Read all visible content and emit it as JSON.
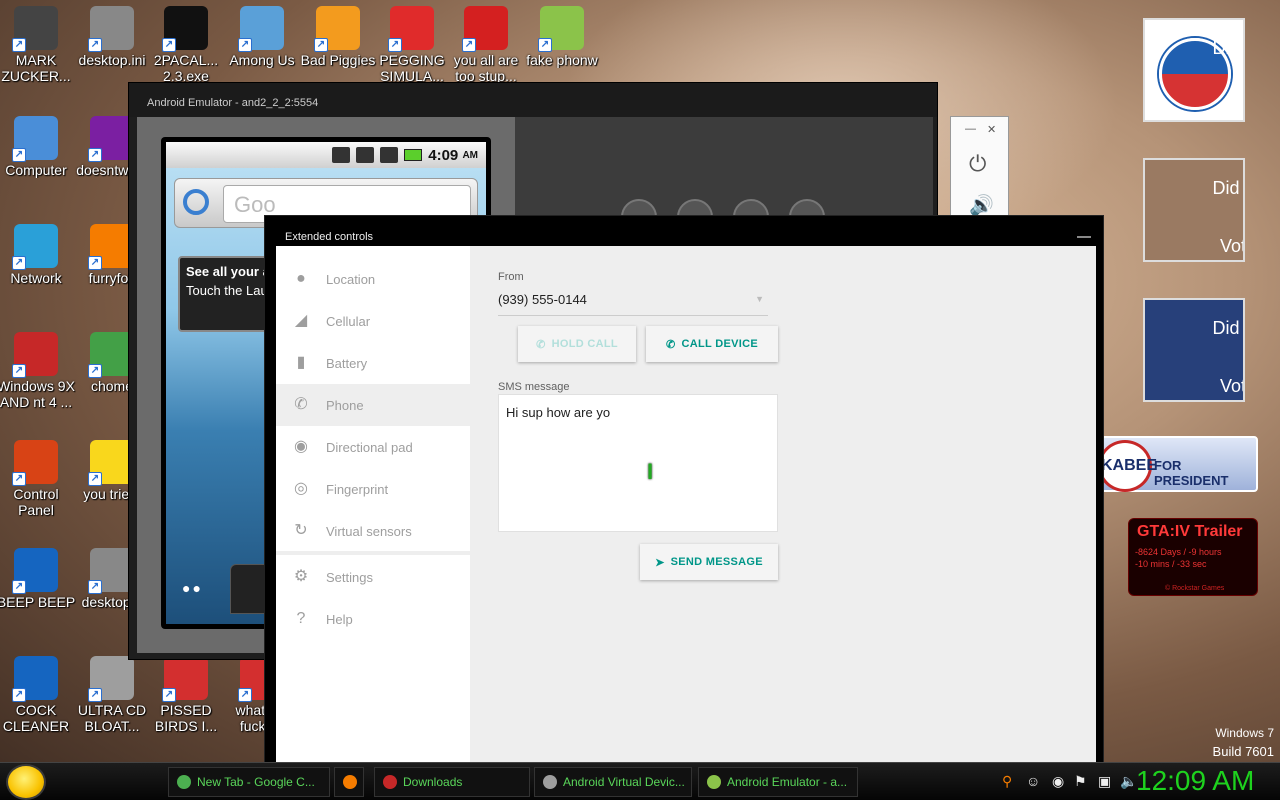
{
  "desktop_icons": [
    {
      "label": "MARK ZUCKER...",
      "icon": "mark-zuckerberg-icon",
      "color": "#444"
    },
    {
      "label": "desktop.ini",
      "icon": "settings-file-icon",
      "color": "#888"
    },
    {
      "label": "2PACAL... 2.3.exe",
      "icon": "console-icon",
      "color": "#111"
    },
    {
      "label": "Among Us",
      "icon": "among-us-icon",
      "color": "#5aa0d8"
    },
    {
      "label": "Bad Piggies",
      "icon": "bad-piggies-icon",
      "color": "#f39b1e"
    },
    {
      "label": "PEGGING SIMULA...",
      "icon": "pegging-icon",
      "color": "#e02b2b"
    },
    {
      "label": "you all are too stup...",
      "icon": "dev-cpp-icon",
      "color": "#d42020"
    },
    {
      "label": "fake phonw",
      "icon": "android-icon",
      "color": "#8bc34a"
    },
    {
      "label": "Computer",
      "icon": "computer-icon",
      "color": "#4a8ed8"
    },
    {
      "label": "doesntwo...",
      "icon": "yahoo-icon",
      "color": "#7b1fa2"
    },
    {
      "label": "Network",
      "icon": "network-icon",
      "color": "#2aa0d8"
    },
    {
      "label": "furryfox",
      "icon": "firefox-icon",
      "color": "#f57c00"
    },
    {
      "label": "Windows 9X AND nt 4 ...",
      "icon": "recycle-bin-icon",
      "color": "#c62828"
    },
    {
      "label": "chome",
      "icon": "chrome-icon",
      "color": "#43a047"
    },
    {
      "label": "Control Panel",
      "icon": "control-panel-icon",
      "color": "#d84315"
    },
    {
      "label": "you trie...",
      "icon": "star-icon",
      "color": "#f9d71c"
    },
    {
      "label": "BEEP BEEP",
      "icon": "bluescreen-icon",
      "color": "#1565c0"
    },
    {
      "label": "desktop...",
      "icon": "settings-file-icon",
      "color": "#888"
    },
    {
      "label": "COCK CLEANER",
      "icon": "bluescreen-icon",
      "color": "#1565c0"
    },
    {
      "label": "ULTRA CD BLOAT...",
      "icon": "cd-icon",
      "color": "#9e9e9e"
    },
    {
      "label": "PISSED BIRDS I...",
      "icon": "angry-birds-icon",
      "color": "#d32f2f"
    },
    {
      "label": "what the fuck i...",
      "icon": "angry-birds-icon",
      "color": "#d32f2f"
    }
  ],
  "gadgets": [
    {
      "line1": "Did you",
      "line2": "Vote?",
      "name": "vote-gadget-obama"
    },
    {
      "line1": "Did you",
      "line2": "Vote?",
      "name": "vote-gadget-mccain"
    },
    {
      "line1": "Did you",
      "line2": "Vote?",
      "name": "vote-gadget-clinton"
    }
  ],
  "huckabee": {
    "text": "KABEE",
    "sub": "FOR PRESIDENT"
  },
  "gta": {
    "title": "GTA:IV  Trailer",
    "line1": "-8624 Days / -9 hours",
    "line2": "-10 mins / -33 sec",
    "brand": "© Rockstar Games"
  },
  "emulator": {
    "title": "Android Emulator - and2_2_2:5554",
    "time": "4:09",
    "ampm": "AM",
    "search_placeholder": "Goo",
    "tip_title": "See all your a",
    "tip_text": "Touch the Lau"
  },
  "extended": {
    "title": "Extended controls",
    "nav": [
      {
        "label": "Location",
        "icon": "location-pin-icon",
        "glyph": "●"
      },
      {
        "label": "Cellular",
        "icon": "cellular-signal-icon",
        "glyph": "◢"
      },
      {
        "label": "Battery",
        "icon": "battery-icon",
        "glyph": "▮"
      },
      {
        "label": "Phone",
        "icon": "phone-icon",
        "glyph": "✆"
      },
      {
        "label": "Directional pad",
        "icon": "dpad-icon",
        "glyph": "◉"
      },
      {
        "label": "Fingerprint",
        "icon": "fingerprint-icon",
        "glyph": "◎"
      },
      {
        "label": "Virtual sensors",
        "icon": "rotate-icon",
        "glyph": "↻"
      },
      {
        "label": "Settings",
        "icon": "gear-icon",
        "glyph": "⚙"
      },
      {
        "label": "Help",
        "icon": "help-icon",
        "glyph": "?"
      }
    ],
    "selected": "Phone",
    "from_label": "From",
    "from_value": "(939) 555-0144",
    "hold_call": "HOLD CALL",
    "call_device": "CALL DEVICE",
    "sms_label": "SMS message",
    "sms_value": "Hi sup how are yo",
    "send_message": "SEND MESSAGE"
  },
  "watermark": {
    "line1": "Windows 7",
    "line2": "Build 7601"
  },
  "taskbar": {
    "buttons": [
      {
        "label": "New Tab - Google C...",
        "icon": "chrome-icon"
      },
      {
        "label": "",
        "icon": "firefox-icon"
      },
      {
        "label": "Downloads",
        "icon": "folder-icon"
      },
      {
        "label": "Android Virtual Devic...",
        "icon": "avd-icon"
      },
      {
        "label": "Android Emulator - a...",
        "icon": "emulator-icon"
      }
    ],
    "clock": "12:09 AM"
  }
}
